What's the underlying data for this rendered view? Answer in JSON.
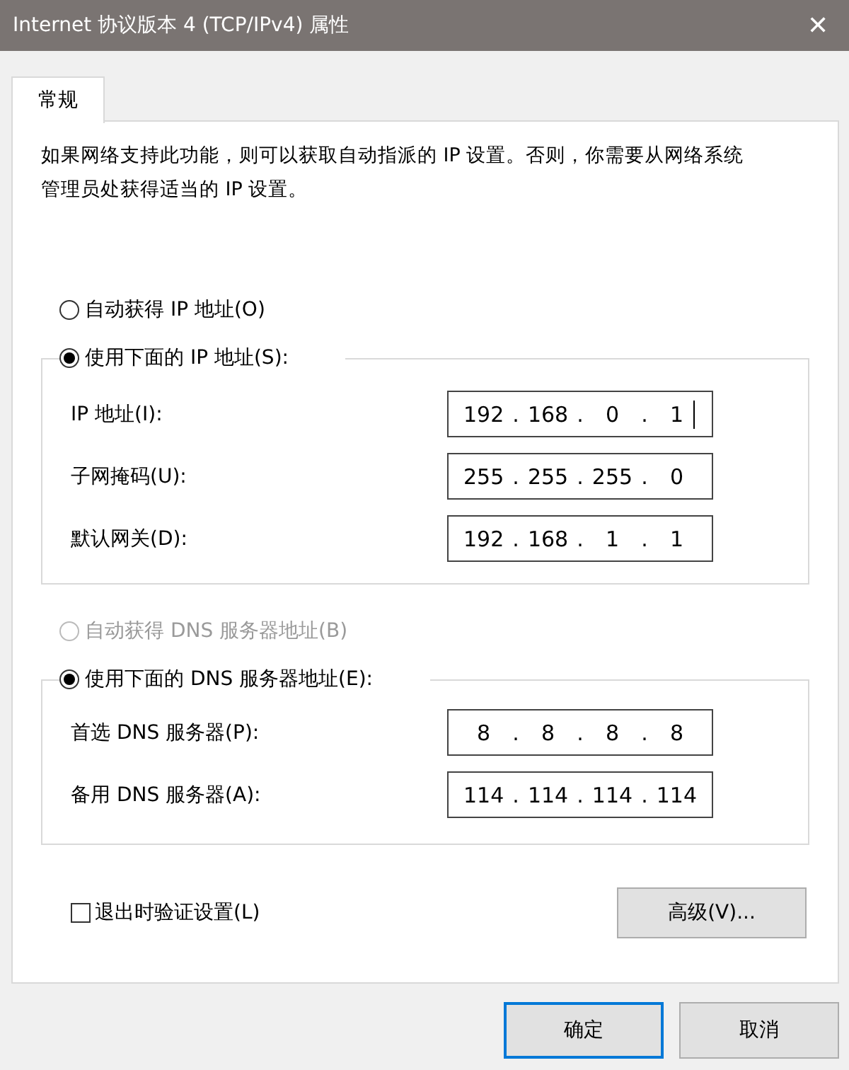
{
  "window": {
    "title": "Internet 协议版本 4 (TCP/IPv4) 属性",
    "close": "✕"
  },
  "tabs": [
    {
      "label": "常规",
      "selected": true
    }
  ],
  "description": "如果网络支持此功能，则可以获取自动指派的 IP 设置。否则，你需要从网络系统管理员处获得适当的 IP 设置。",
  "ip_options": [
    {
      "label": "自动获得 IP 地址(O)",
      "selected": false,
      "disabled": false
    },
    {
      "label": "使用下面的 IP 地址(S):",
      "selected": true,
      "disabled": false
    }
  ],
  "ip_fields": [
    {
      "label": "IP 地址(I):",
      "octets": [
        "192",
        ".",
        "168",
        ".",
        "0",
        ".",
        "1"
      ],
      "focused": true
    },
    {
      "label": "子网掩码(U):",
      "octets": [
        "255",
        ".",
        "255",
        ".",
        "255",
        ".",
        "0"
      ],
      "focused": false
    },
    {
      "label": "默认网关(D):",
      "octets": [
        "192",
        ".",
        "168",
        ".",
        "1",
        ".",
        "1"
      ],
      "focused": false
    }
  ],
  "dns_options": [
    {
      "label": "自动获得 DNS 服务器地址(B)",
      "selected": false,
      "disabled": true
    },
    {
      "label": "使用下面的 DNS 服务器地址(E):",
      "selected": true,
      "disabled": false
    }
  ],
  "dns_fields": [
    {
      "label": "首选 DNS 服务器(P):",
      "octets": [
        "8",
        ".",
        "8",
        ".",
        "8",
        ".",
        "8"
      ],
      "focused": false
    },
    {
      "label": "备用 DNS 服务器(A):",
      "octets": [
        "114",
        ".",
        "114",
        ".",
        "114",
        ".",
        "114"
      ],
      "focused": false
    }
  ],
  "validate": {
    "label": "退出时验证设置(L)",
    "checked": false
  },
  "advanced_button": "高级(V)...",
  "buttons": [
    {
      "label": "确定",
      "default": true
    },
    {
      "label": "取消",
      "default": false
    }
  ]
}
